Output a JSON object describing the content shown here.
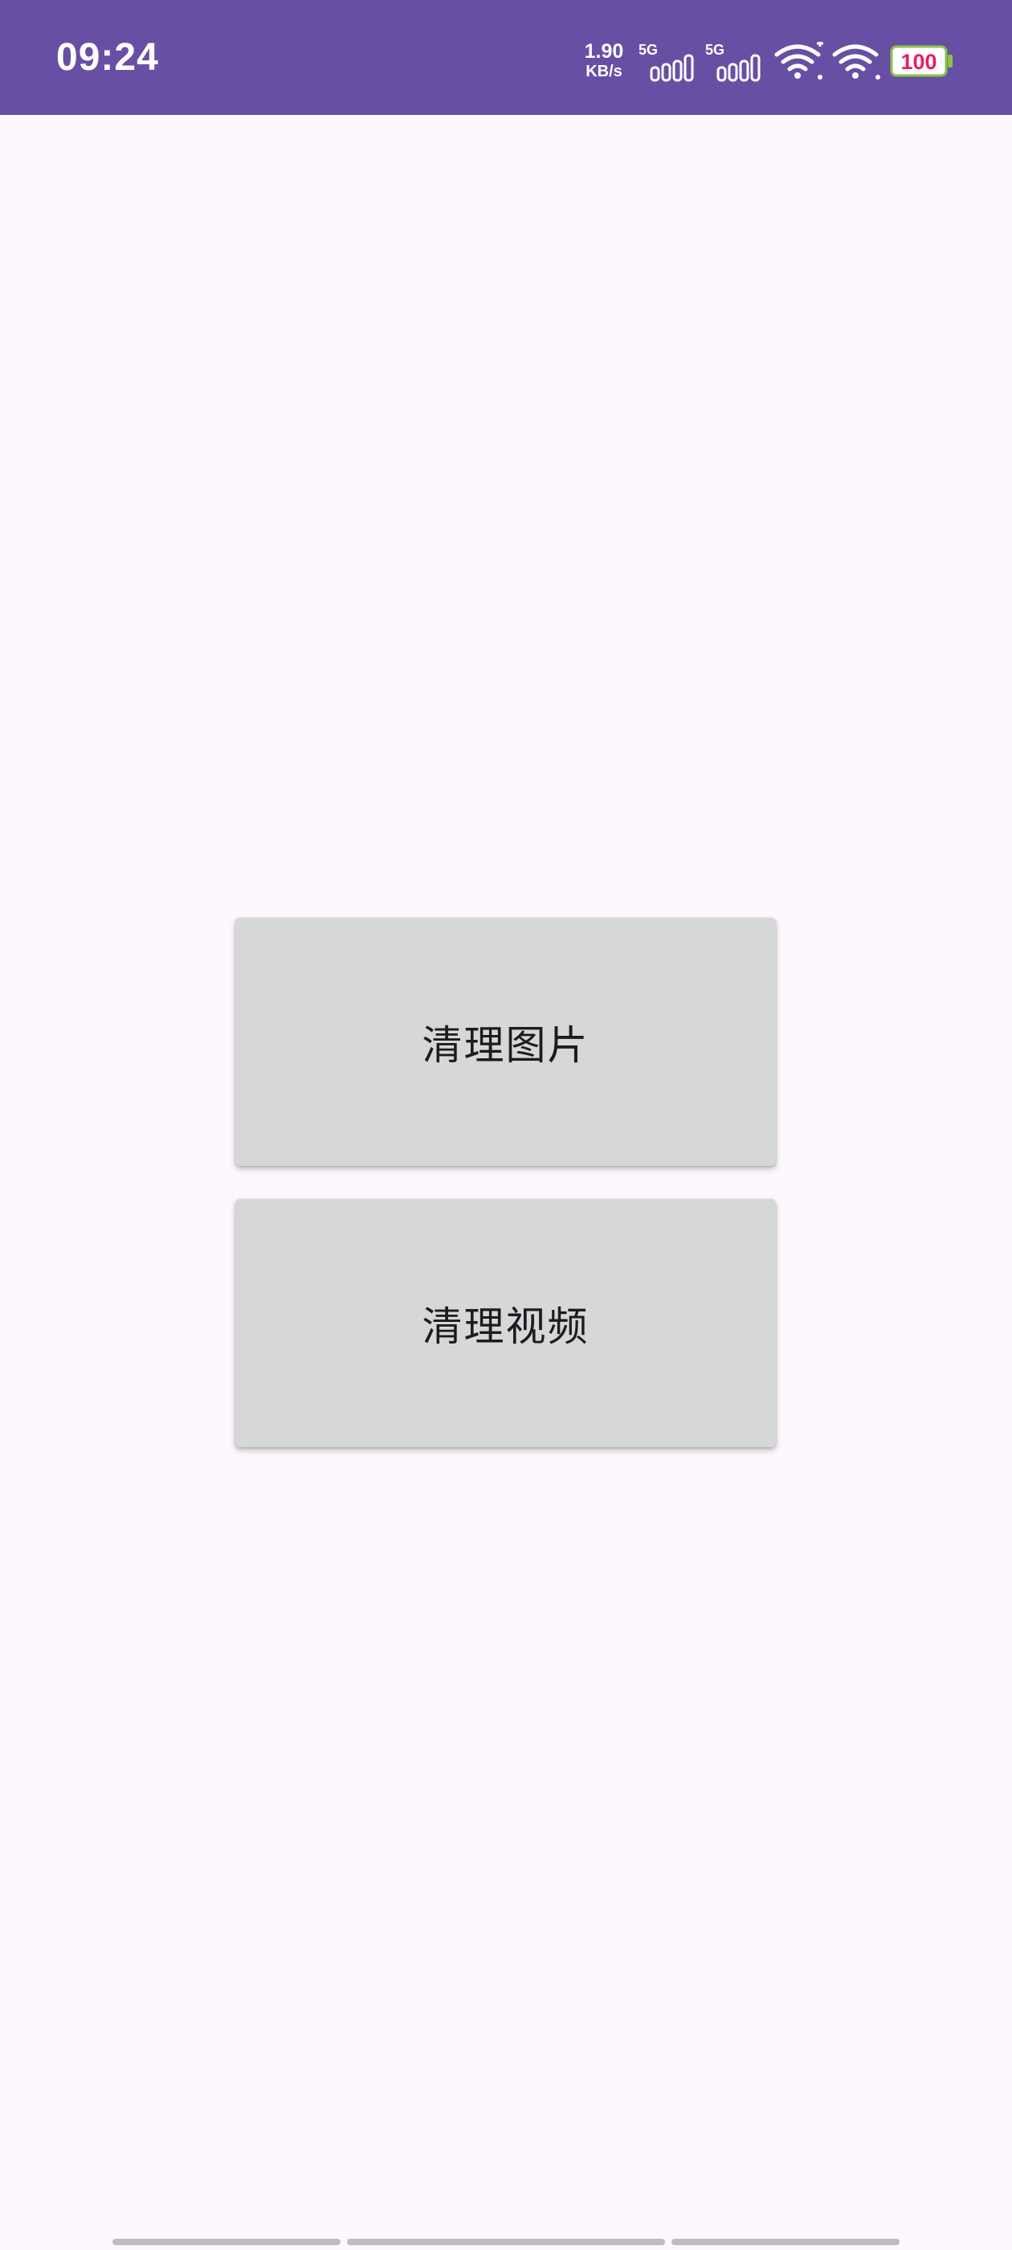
{
  "status_bar": {
    "time": "09:24",
    "net_speed_value": "1.90",
    "net_speed_unit": "KB/s",
    "sim1_type": "5G",
    "sim2_type": "5G",
    "battery_level": "100",
    "background_color": "#6750a4",
    "icons": [
      "signal-5g-icon",
      "signal-5g-icon",
      "wifi-icon",
      "wifi-icon",
      "battery-icon"
    ]
  },
  "main": {
    "buttons": [
      {
        "label": "清理图片"
      },
      {
        "label": "清理视频"
      }
    ]
  },
  "colors": {
    "background": "#fdf8fd",
    "button": "#d6d7d7",
    "button_text": "#1d1b20",
    "battery_text": "#e91e63"
  }
}
